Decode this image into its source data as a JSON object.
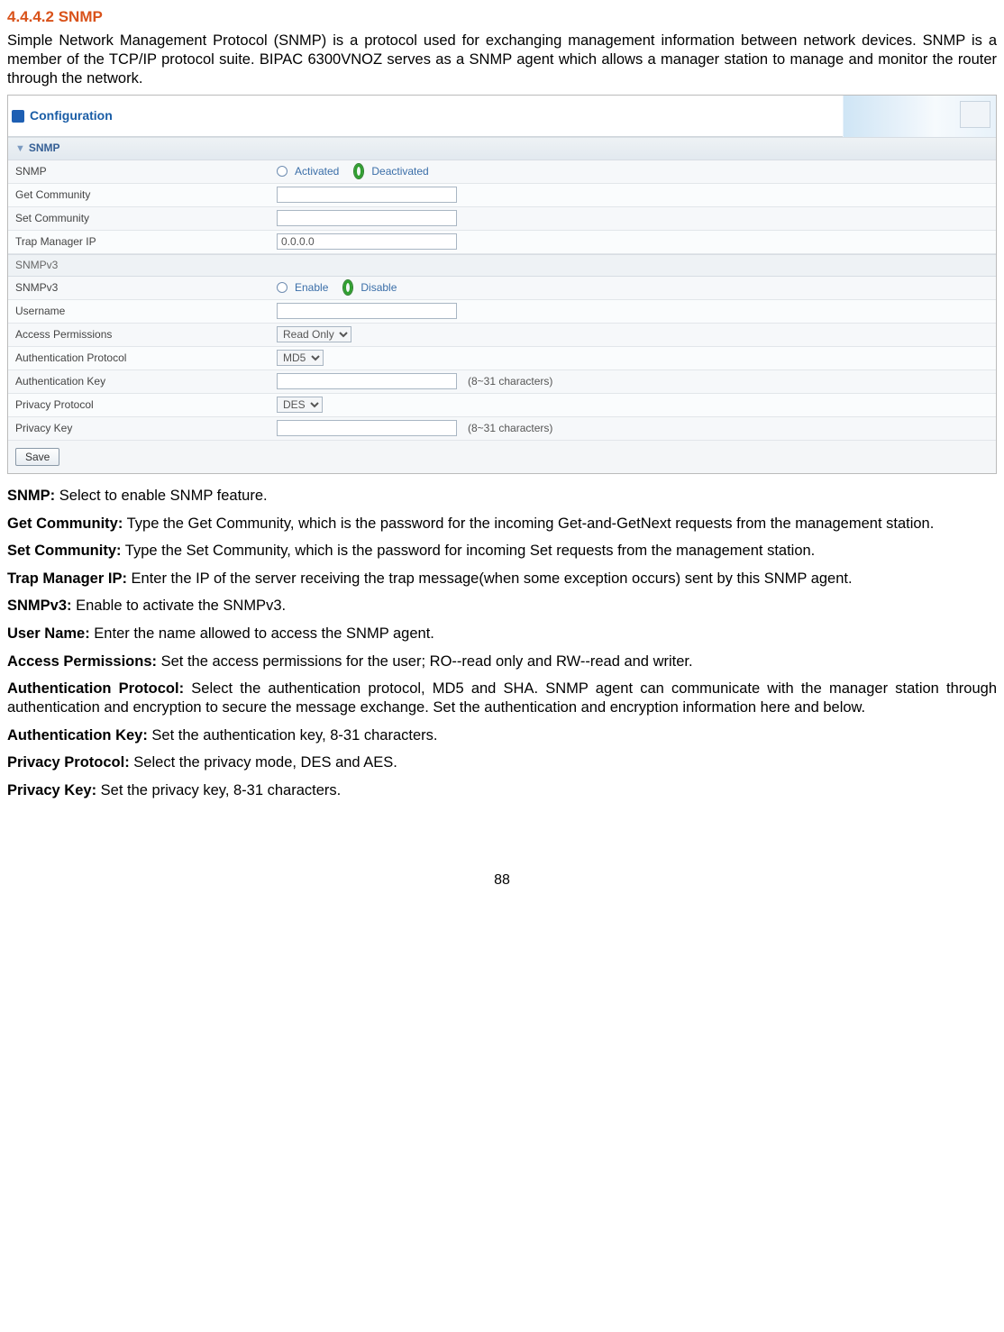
{
  "heading": "4.4.4.2 SNMP",
  "intro": "Simple Network Management Protocol (SNMP) is a protocol used for exchanging management information between network devices. SNMP is a member of the TCP/IP protocol suite. BIPAC 6300VNOZ serves as a SNMP agent which allows a manager station to manage and monitor the router through the network.",
  "config_title": "Configuration",
  "section_snmp": "SNMP",
  "snmp": {
    "row_label": "SNMP",
    "activated": "Activated",
    "deactivated": "Deactivated",
    "get_community_label": "Get Community",
    "set_community_label": "Set Community",
    "trap_label": "Trap Manager IP",
    "trap_value": "0.0.0.0"
  },
  "section_snmpv3": "SNMPv3",
  "snmpv3": {
    "row_label": "SNMPv3",
    "enable": "Enable",
    "disable": "Disable",
    "username_label": "Username",
    "access_label": "Access Permissions",
    "access_value": "Read Only",
    "auth_proto_label": "Authentication Protocol",
    "auth_proto_value": "MD5",
    "auth_key_label": "Authentication Key",
    "key_hint": "(8~31 characters)",
    "priv_proto_label": "Privacy Protocol",
    "priv_proto_value": "DES",
    "priv_key_label": "Privacy Key"
  },
  "save_label": "Save",
  "descs": [
    {
      "term": "SNMP:",
      "text": " Select to enable SNMP feature."
    },
    {
      "term": "Get Community:",
      "text": " Type the Get Community, which is the password for the incoming Get-and-GetNext requests from the management station."
    },
    {
      "term": "Set Community:",
      "text": " Type the Set Community, which is the password for incoming Set requests from the management station."
    },
    {
      "term": "Trap Manager IP:",
      "text": " Enter the IP of the server receiving the trap message(when some exception occurs) sent by this SNMP agent."
    },
    {
      "term": "SNMPv3:",
      "text": " Enable to activate the SNMPv3."
    },
    {
      "term": "User Name:",
      "text": " Enter the name allowed to access the SNMP agent."
    },
    {
      "term": "Access Permissions:",
      "text": " Set the access permissions for the user; RO--read only and RW--read and writer."
    },
    {
      "term": "Authentication Protocol:",
      "text": " Select the authentication protocol, MD5 and SHA. SNMP agent can communicate with the manager station through authentication and encryption to secure the message exchange. Set the authentication and encryption information here and below."
    },
    {
      "term": "Authentication Key:",
      "text": " Set the authentication key, 8-31 characters."
    },
    {
      "term": "Privacy Protocol:",
      "text": " Select the privacy mode, DES and AES."
    },
    {
      "term": "Privacy Key:",
      "text": " Set the privacy key, 8-31 characters."
    }
  ],
  "page_number": "88"
}
